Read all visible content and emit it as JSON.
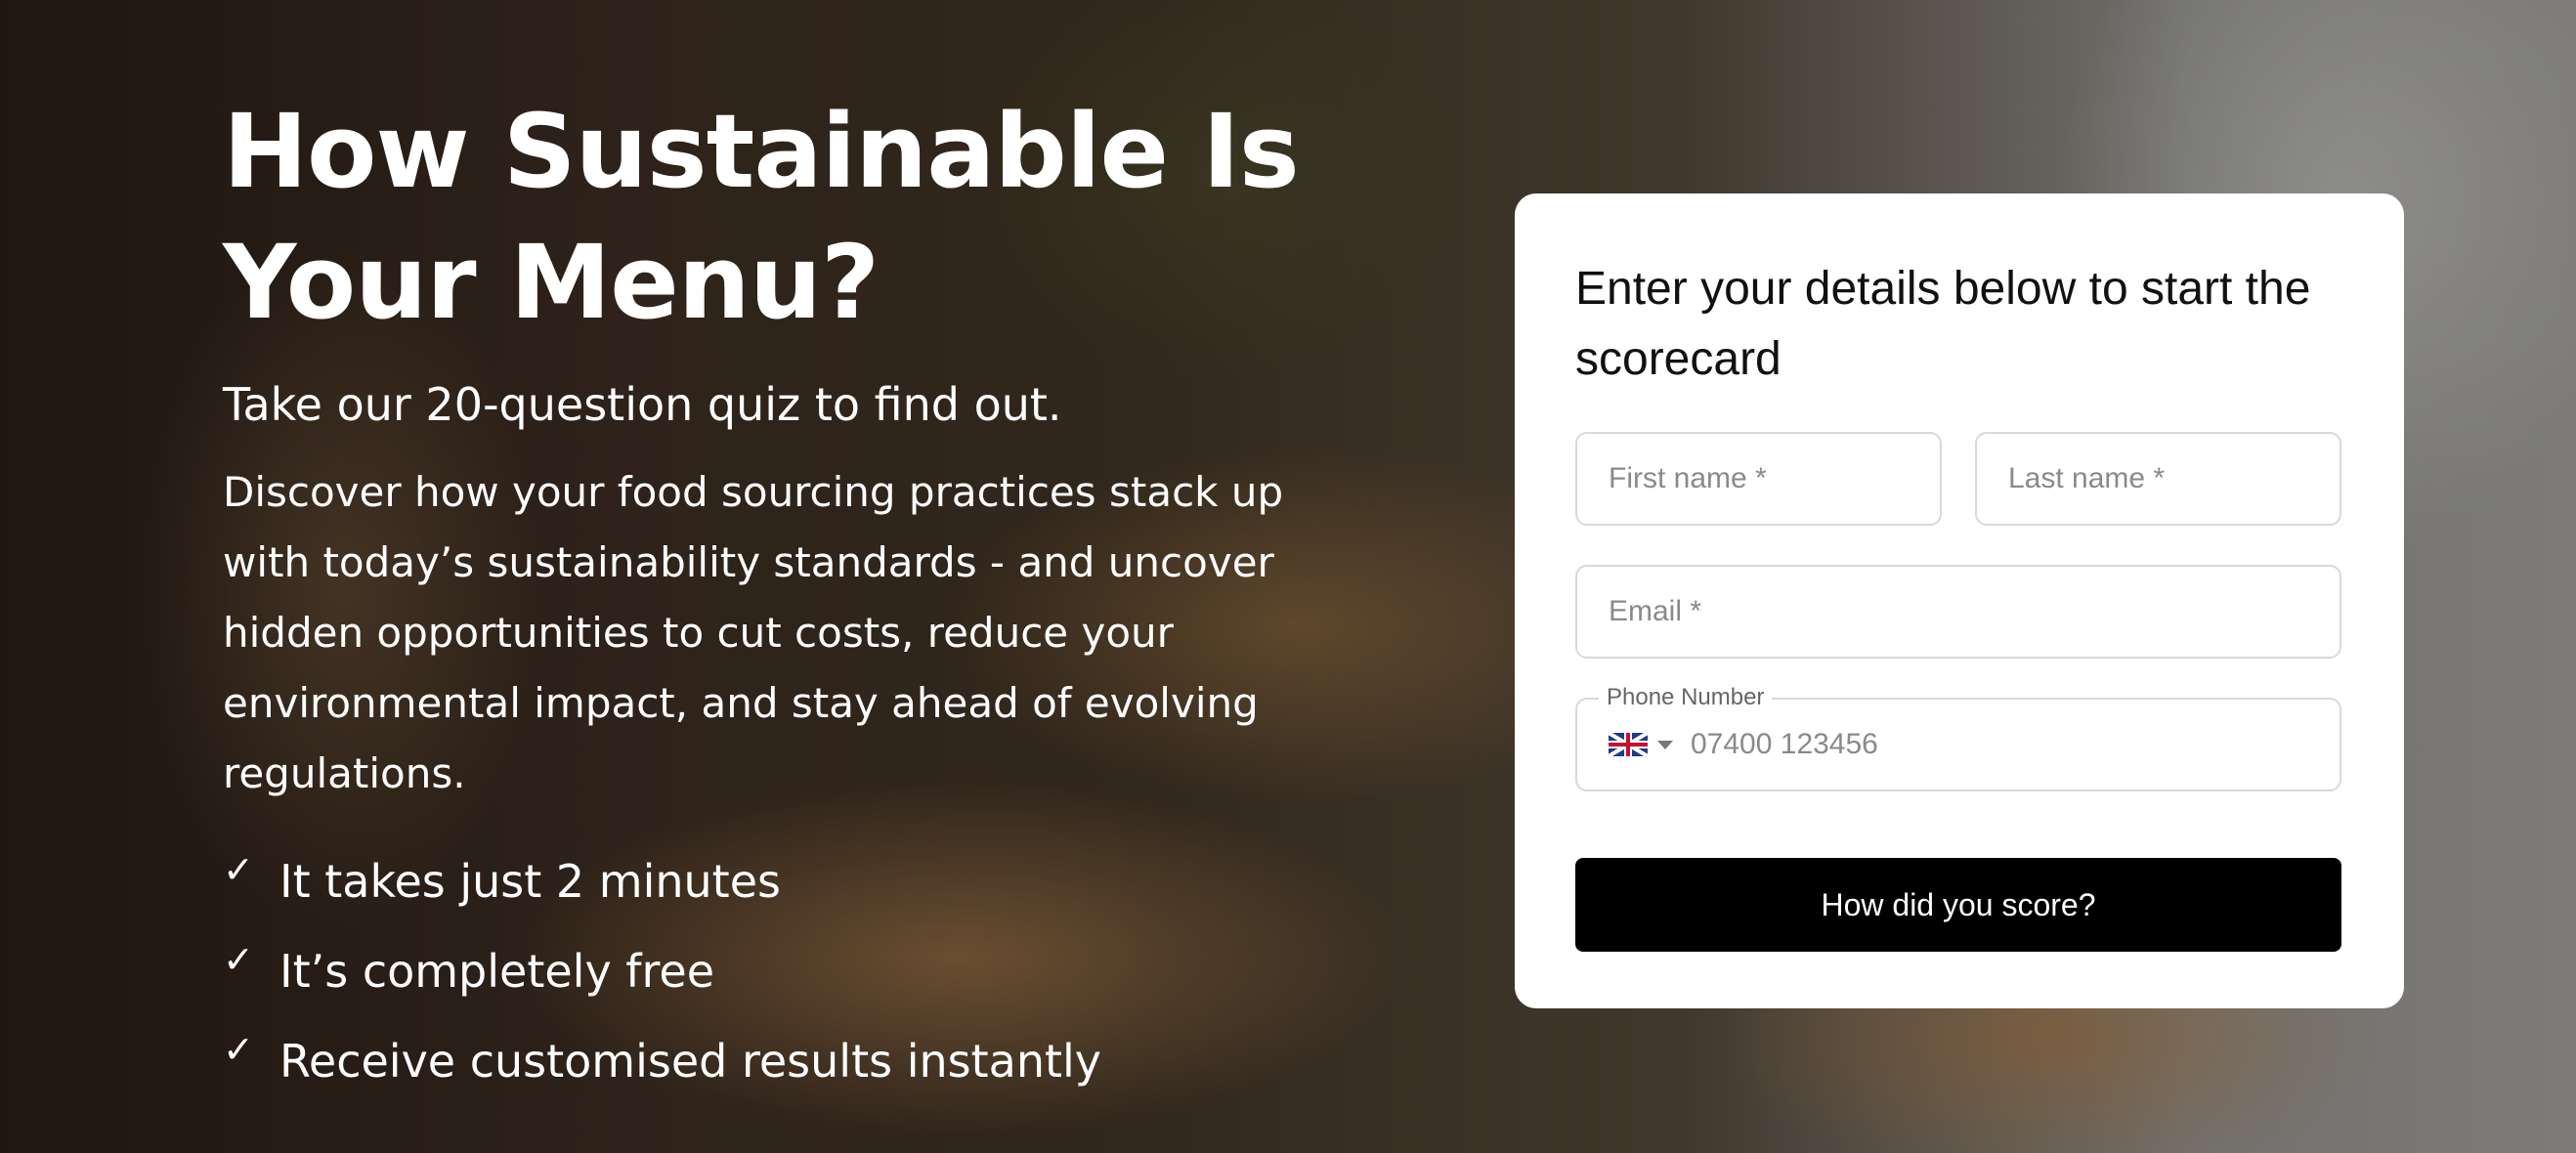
{
  "hero": {
    "title_line1": "How Sustainable Is",
    "title_line2": "Your Menu?",
    "subtitle": "Take our 20-question quiz to find out.",
    "description": "Discover how your food sourcing practices stack up with today’s sustainability standards - and uncover hidden opportunities to cut costs, reduce your environmental impact, and stay ahead of evolving regulations.",
    "benefits": [
      "It takes just 2 minutes",
      "It’s completely free",
      "Receive customised results instantly"
    ],
    "check_glyph": "✓"
  },
  "form": {
    "heading": "Enter your details below to start the scorecard",
    "first_name_placeholder": "First name *",
    "last_name_placeholder": "Last name *",
    "email_placeholder": "Email *",
    "phone_label": "Phone Number",
    "phone_placeholder": "07400 123456",
    "country_icon": "uk-flag-icon",
    "submit_label": "How did you score?"
  },
  "colors": {
    "card_background": "#ffffff",
    "button_background": "#000000",
    "button_text": "#ffffff",
    "hero_text": "#ffffff"
  }
}
